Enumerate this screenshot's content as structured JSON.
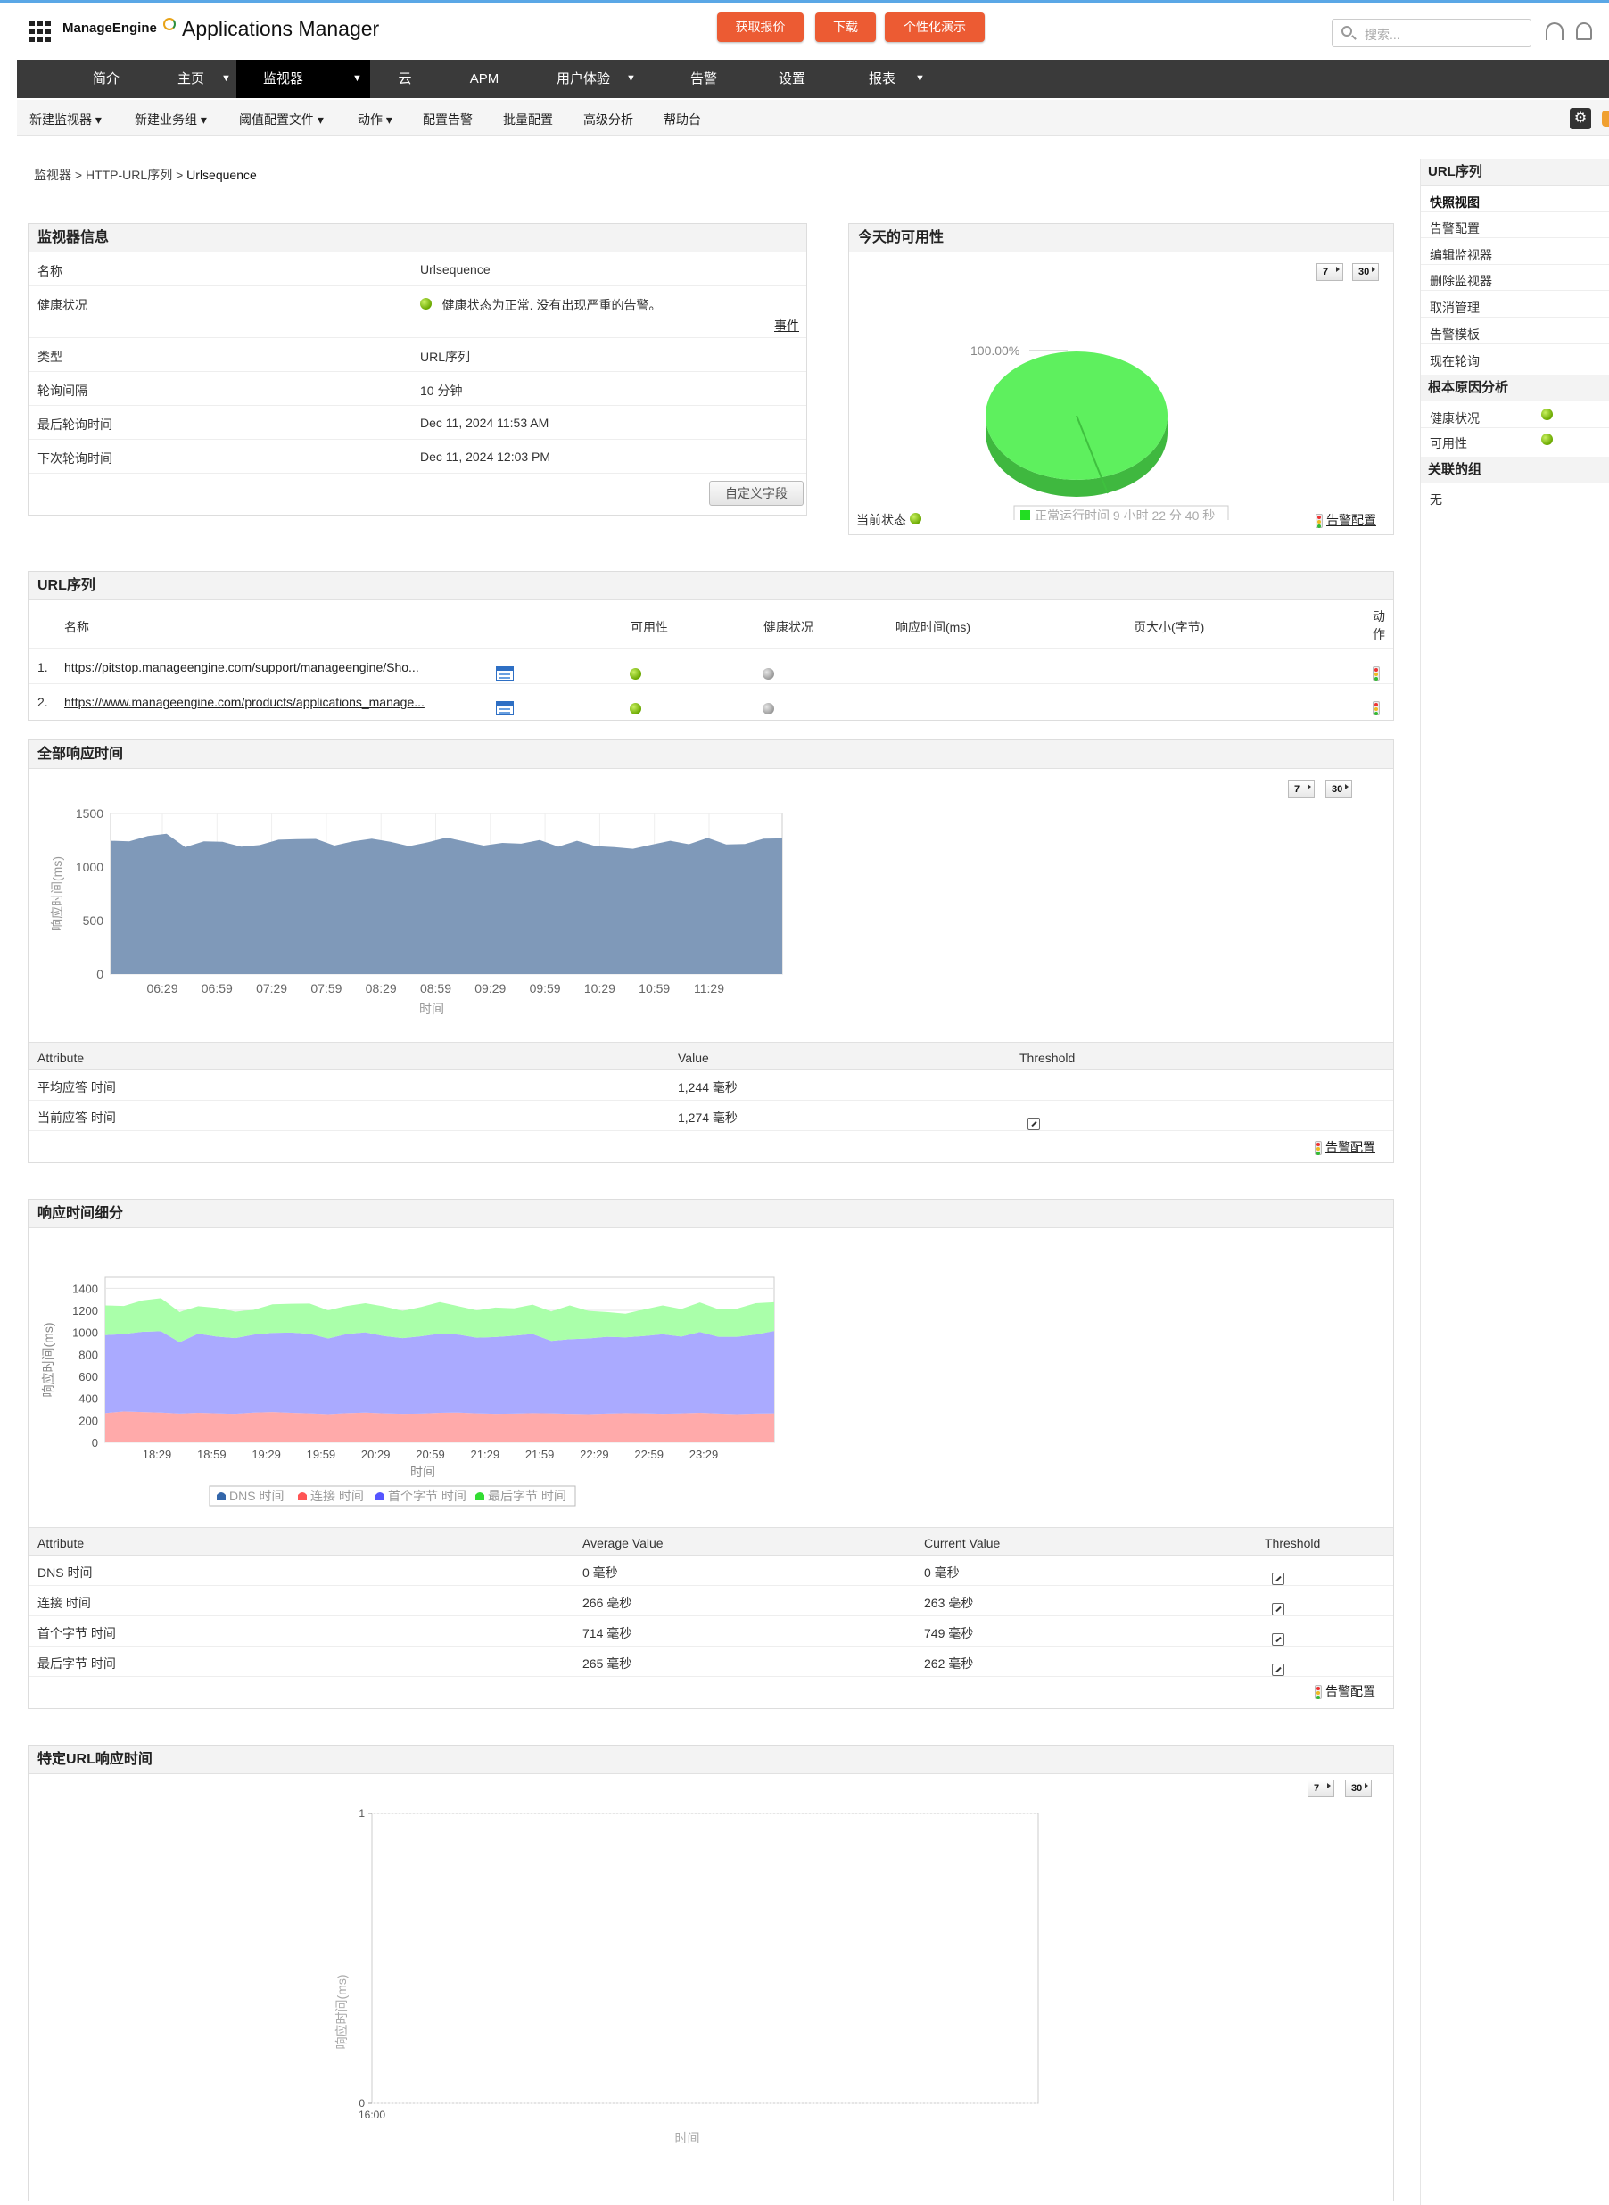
{
  "header": {
    "brand": "ManageEngine",
    "app_name": "Applications Manager",
    "btn_quote": "获取报价",
    "btn_download": "下载",
    "btn_demo": "个性化演示",
    "search_placeholder": "搜索..."
  },
  "nav": {
    "items": [
      {
        "label": "简介",
        "caret": false
      },
      {
        "label": "主页",
        "caret": true
      },
      {
        "label": "监视器",
        "caret": true,
        "active": true
      },
      {
        "label": "云",
        "caret": false
      },
      {
        "label": "APM",
        "caret": false
      },
      {
        "label": "用户体验",
        "caret": true
      },
      {
        "label": "告警",
        "caret": false
      },
      {
        "label": "设置",
        "caret": false
      },
      {
        "label": "报表",
        "caret": true
      }
    ]
  },
  "subnav": {
    "items": [
      "新建监视器 ▾",
      "新建业务组 ▾",
      "阈值配置文件 ▾",
      "动作 ▾",
      "配置告警",
      "批量配置",
      "高级分析",
      "帮助台"
    ]
  },
  "breadcrumb": {
    "part1": "监视器",
    "sep": " > ",
    "part2": "HTTP-URL序列",
    "current": "Urlsequence"
  },
  "monitor_info": {
    "title": "监视器信息",
    "rows": [
      {
        "key": "名称",
        "value": "Urlsequence"
      },
      {
        "key": "健康状况",
        "value": "健康状态为正常. 没有出现严重的告警。"
      },
      {
        "key": "类型",
        "value": "URL序列"
      },
      {
        "key": "轮询间隔",
        "value": "10 分钟"
      },
      {
        "key": "最后轮询时间",
        "value": "Dec 11, 2024 11:53 AM"
      },
      {
        "key": "下次轮询时间",
        "value": "Dec 11, 2024 12:03 PM"
      }
    ],
    "events_link": "事件",
    "custom_fields_btn": "自定义字段"
  },
  "availability": {
    "title": "今天的可用性",
    "pct_label": "100.00%",
    "legend": "正常运行时间 9 小时 22 分 40 秒",
    "current_status": "当前状态",
    "alert_config": "告警配置",
    "range7": "7",
    "range30": "30",
    "colors": {
      "up": "#4cd04c",
      "up_light": "#66f066"
    }
  },
  "url_seq": {
    "title": "URL序列",
    "headers": {
      "name": "名称",
      "avail": "可用性",
      "health": "健康状况",
      "resp": "响应时间(ms)",
      "size": "页大小(字节)",
      "action": "动\n作"
    },
    "rows": [
      {
        "idx": "1.",
        "url": "https://pitstop.manageengine.com/support/manageengine/Sho..."
      },
      {
        "idx": "2.",
        "url": "https://www.manageengine.com/products/applications_manage..."
      }
    ]
  },
  "overall_resp": {
    "title": "全部响应时间",
    "range7": "7",
    "range30": "30",
    "table": {
      "headers": [
        "Attribute",
        "Value",
        "Threshold"
      ],
      "rows": [
        {
          "attr": "平均应答 时间",
          "value": "1,244 毫秒"
        },
        {
          "attr": "当前应答 时间",
          "value": "1,274 毫秒"
        }
      ]
    },
    "alert_config": "告警配置"
  },
  "breakdown": {
    "title": "响应时间细分",
    "table": {
      "headers": [
        "Attribute",
        "Average Value",
        "Current Value",
        "Threshold"
      ],
      "rows": [
        {
          "attr": "DNS 时间",
          "avg": "0 毫秒",
          "cur": "0 毫秒"
        },
        {
          "attr": "连接 时间",
          "avg": "266 毫秒",
          "cur": "263 毫秒"
        },
        {
          "attr": "首个字节 时间",
          "avg": "714 毫秒",
          "cur": "749 毫秒"
        },
        {
          "attr": "最后字节 时间",
          "avg": "265 毫秒",
          "cur": "262 毫秒"
        }
      ]
    },
    "alert_config": "告警配置"
  },
  "specific_url": {
    "title": "特定URL响应时间",
    "range7": "7",
    "range30": "30"
  },
  "sidebar": {
    "sections": [
      {
        "title": "URL序列",
        "items": [
          "快照视图",
          "告警配置",
          "编辑监视器",
          "删除监视器",
          "取消管理",
          "告警模板",
          "现在轮询"
        ]
      },
      {
        "title": "根本原因分析",
        "items": [
          "健康状况",
          "可用性"
        ]
      },
      {
        "title": "关联的组",
        "items": [
          "无"
        ]
      }
    ]
  },
  "chart_data": [
    {
      "type": "pie",
      "title": "今天的可用性",
      "slices": [
        {
          "label": "正常运行时间 9 小时 22 分 40 秒",
          "value": 100.0
        }
      ],
      "pct_label": "100.00%",
      "color": "#4cd04c"
    },
    {
      "type": "area",
      "title": "全部响应时间",
      "xlabel": "时间",
      "ylabel": "响应时间(ms)",
      "ylim": [
        0,
        1500
      ],
      "yticks": [
        0,
        500,
        1000,
        1500
      ],
      "x_ticks": [
        "06:29",
        "06:59",
        "07:29",
        "07:59",
        "08:29",
        "08:59",
        "09:29",
        "09:59",
        "10:29",
        "10:59",
        "11:29"
      ],
      "x": [
        0,
        1,
        2,
        3,
        4,
        5,
        6,
        7,
        8,
        9,
        10,
        11,
        12,
        13,
        14,
        15,
        16,
        17,
        18,
        19,
        20,
        21,
        22,
        23,
        24,
        25,
        26,
        27,
        28,
        29,
        30,
        31,
        32,
        33,
        34,
        35,
        36
      ],
      "series": [
        {
          "name": "",
          "color": "#7f99b9",
          "values": [
            1245,
            1240,
            1290,
            1310,
            1185,
            1240,
            1235,
            1190,
            1205,
            1255,
            1260,
            1262,
            1200,
            1240,
            1265,
            1235,
            1195,
            1230,
            1275,
            1238,
            1200,
            1225,
            1218,
            1252,
            1190,
            1245,
            1195,
            1185,
            1170,
            1208,
            1245,
            1212,
            1272,
            1210,
            1215,
            1265,
            1268
          ]
        }
      ]
    },
    {
      "type": "area",
      "stacked": true,
      "title": "响应时间细分",
      "xlabel": "时间",
      "ylabel": "响应时间(ms)",
      "ylim": [
        0,
        1500
      ],
      "yticks": [
        0,
        200,
        400,
        600,
        800,
        1000,
        1200,
        1400
      ],
      "x_ticks": [
        "18:29",
        "18:59",
        "19:29",
        "19:59",
        "20:29",
        "20:59",
        "21:29",
        "21:59",
        "22:29",
        "22:59",
        "23:29"
      ],
      "x": [
        0,
        1,
        2,
        3,
        4,
        5,
        6,
        7,
        8,
        9,
        10,
        11,
        12,
        13,
        14,
        15,
        16,
        17,
        18,
        19,
        20,
        21,
        22,
        23,
        24,
        25,
        26,
        27,
        28,
        29,
        30,
        31,
        32,
        33,
        34,
        35,
        36
      ],
      "legend": "bottom",
      "series": [
        {
          "name": "DNS 时间",
          "color": "#3366aa",
          "values": [
            0,
            0,
            0,
            0,
            0,
            0,
            0,
            0,
            0,
            0,
            0,
            0,
            0,
            0,
            0,
            0,
            0,
            0,
            0,
            0,
            0,
            0,
            0,
            0,
            0,
            0,
            0,
            0,
            0,
            0,
            0,
            0,
            0,
            0,
            0,
            0,
            0
          ]
        },
        {
          "name": "连接 时间",
          "color": "#ffaaaa",
          "values": [
            265,
            280,
            275,
            270,
            260,
            268,
            262,
            258,
            270,
            275,
            268,
            262,
            255,
            265,
            270,
            262,
            258,
            260,
            268,
            270,
            262,
            258,
            260,
            265,
            262,
            258,
            255,
            260,
            265,
            262,
            258,
            262,
            268,
            260,
            255,
            260,
            263
          ]
        },
        {
          "name": "首个字节 时间",
          "color": "#aaaaff",
          "values": [
            710,
            705,
            730,
            740,
            650,
            720,
            700,
            690,
            710,
            720,
            730,
            725,
            690,
            720,
            730,
            705,
            690,
            705,
            720,
            710,
            690,
            700,
            710,
            720,
            660,
            680,
            690,
            700,
            690,
            705,
            725,
            700,
            735,
            700,
            705,
            720,
            749
          ]
        },
        {
          "name": "最后字节 时间",
          "color": "#aaffaa",
          "values": [
            270,
            255,
            285,
            300,
            275,
            250,
            260,
            240,
            225,
            260,
            262,
            275,
            255,
            255,
            265,
            268,
            247,
            265,
            287,
            258,
            248,
            267,
            248,
            267,
            268,
            307,
            250,
            225,
            215,
            241,
            262,
            250,
            269,
            250,
            255,
            285,
            262
          ]
        }
      ]
    },
    {
      "type": "line",
      "title": "特定URL响应时间",
      "xlabel": "时间",
      "ylabel": "响应时间(ms)",
      "ylim": [
        0,
        1
      ],
      "yticks": [
        0,
        1
      ],
      "x_ticks": [
        "16:00"
      ],
      "series": []
    }
  ]
}
